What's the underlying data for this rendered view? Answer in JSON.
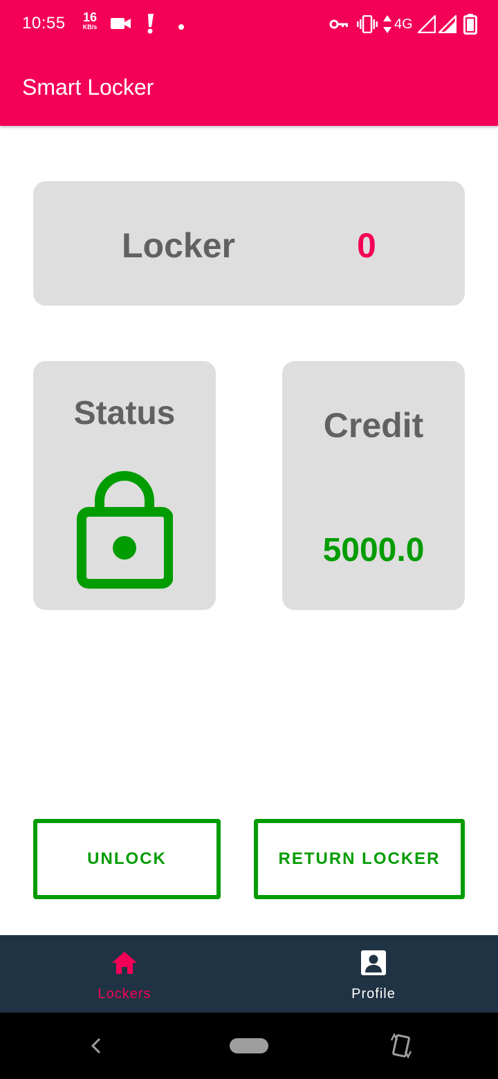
{
  "status_bar": {
    "time": "10:55",
    "net_speed_value": "16",
    "net_speed_unit": "KB/s",
    "network_type": "4G",
    "icons": [
      "video-camera-icon",
      "alert-icon",
      "dot-icon",
      "vpn-key-icon",
      "vibrate-icon",
      "data-arrows-icon",
      "signal-icon",
      "signal-icon",
      "battery-icon"
    ]
  },
  "app_bar": {
    "title": "Smart Locker"
  },
  "locker_card": {
    "label": "Locker",
    "value": "0"
  },
  "status_card": {
    "label": "Status",
    "icon": "lock-open-icon"
  },
  "credit_card": {
    "label": "Credit",
    "value": "5000.0"
  },
  "actions": {
    "unlock_label": "UNLOCK",
    "return_label": "RETURN LOCKER"
  },
  "bottom_nav": {
    "items": [
      {
        "label": "Lockers",
        "icon": "home-icon",
        "active": true
      },
      {
        "label": "Profile",
        "icon": "profile-icon",
        "active": false
      }
    ]
  },
  "colors": {
    "primary": "#F50057",
    "success": "#009C00",
    "card_bg": "#DEDEDE",
    "nav_bg": "#203344",
    "label_text": "#616161"
  }
}
